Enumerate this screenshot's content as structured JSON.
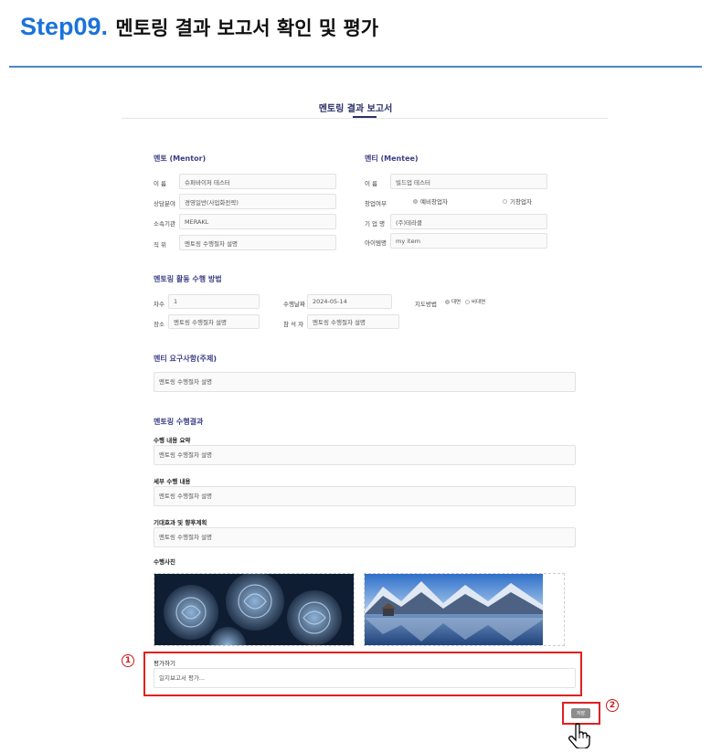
{
  "header": {
    "step": "Step09.",
    "title": "멘토링 결과 보고서 확인 및 평가"
  },
  "report": {
    "title": "멘토링 결과 보고서",
    "mentor": {
      "heading": "멘토 (Mentor)",
      "fields": [
        {
          "label": "이      름",
          "value": "슈퍼바이저 테스터"
        },
        {
          "label": "상담분야",
          "value": "경영일반(사업화전략)"
        },
        {
          "label": "소속기관",
          "value": "MERAKL"
        },
        {
          "label": "직      위",
          "value": "멘토링 수행절차 설명"
        }
      ]
    },
    "mentee": {
      "heading": "멘티 (Mentee)",
      "name_label": "이      름",
      "name_value": "빌드업 테스터",
      "startup_label": "창업여부",
      "startup_options": [
        "예비창업자",
        "기창업자"
      ],
      "company_label": "기 업 명",
      "company_value": "(주)테라클",
      "item_label": "아이템명",
      "item_value": "my item"
    },
    "activity": {
      "heading": "멘토링 활동 수행 방법",
      "round_label": "차수",
      "round_value": "1",
      "date_label": "수행날짜",
      "date_value": "2024-05-14",
      "method_label": "지도방법",
      "method_options": [
        "대면",
        "비대면"
      ],
      "place_label": "장소",
      "place_value": "멘토링 수행절차 설명",
      "attendee_label": "참 석 자",
      "attendee_value": "멘토링 수행절차 설명"
    },
    "request": {
      "heading": "멘티 요구사항(주제)",
      "value": "멘토링 수행절차 설명"
    },
    "result": {
      "heading": "멘토링 수행결과",
      "summary_label": "수행 내용 요약",
      "summary_value": "멘토링 수행절차 설명",
      "detail_label": "세부 수행 내용",
      "detail_value": "멘토링 수행절차 설명",
      "effect_label": "기대효과 및 향후계획",
      "effect_value": "멘토링 수행절차 설명",
      "photo_label": "수행사진"
    },
    "evaluation": {
      "label": "평가하기",
      "placeholder": "일지보고서 평가..."
    },
    "save_label": "저장"
  },
  "annotations": {
    "marker1": "1",
    "marker2": "2",
    "accent": "#e02020"
  },
  "colors": {
    "step_blue": "#1a73d9",
    "section_navy": "#3c3f86"
  }
}
